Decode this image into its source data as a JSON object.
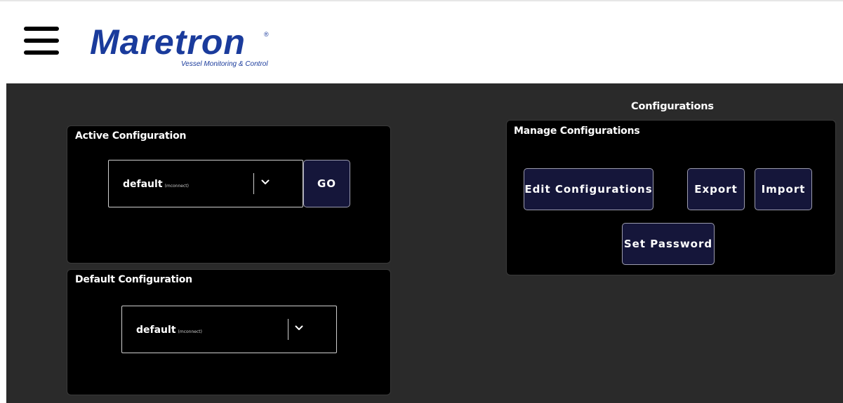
{
  "header": {
    "menu_icon": "hamburger-menu-icon",
    "logo": {
      "wordmark": "Maretron",
      "registered": "®",
      "tagline": "Vessel Monitoring & Control",
      "color": "#1a3b9c"
    }
  },
  "active_config": {
    "title": "Active Configuration",
    "selected": "default",
    "selected_sub": "(mconnect)",
    "chevron_icon": "chevron-down-icon",
    "go_label": "GO"
  },
  "default_config": {
    "title": "Default Configuration",
    "selected": "default",
    "selected_sub": "(mconnect)",
    "chevron_icon": "chevron-down-icon"
  },
  "configurations": {
    "heading": "Configurations",
    "manage": {
      "title": "Manage Configurations",
      "edit_label": "Edit Configurations",
      "export_label": "Export",
      "import_label": "Import",
      "set_password_label": "Set Password"
    }
  },
  "colors": {
    "background_dark": "#2a2a2a",
    "panel": "#000000",
    "button_bg": "#15163a",
    "button_border": "#9c9cae"
  }
}
